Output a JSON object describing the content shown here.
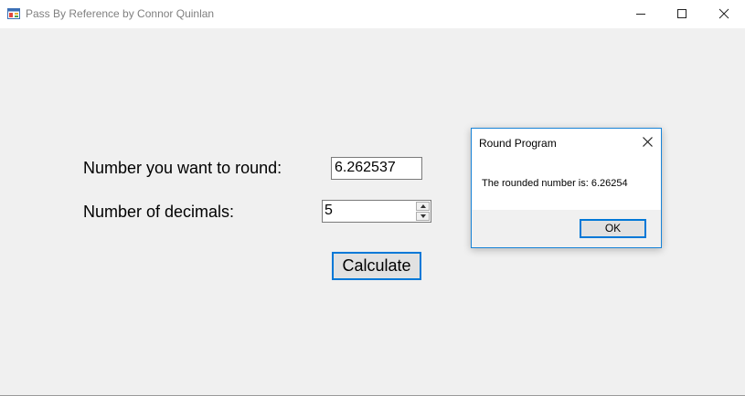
{
  "window": {
    "title": "Pass By Reference by Connor Quinlan",
    "icon": "app-window-icon",
    "controls": [
      "minimize-icon",
      "maximize-icon",
      "close-icon"
    ]
  },
  "form": {
    "number_label": "Number you want to round:",
    "number_value": "6.262537",
    "decimals_label": "Number of decimals:",
    "decimals_value": "5",
    "calculate_label": "Calculate"
  },
  "dialog": {
    "title": "Round Program",
    "message": "The rounded number is: 6.26254",
    "ok_label": "OK"
  },
  "colors": {
    "accent": "#0078d7",
    "background": "#f0f0f0"
  }
}
